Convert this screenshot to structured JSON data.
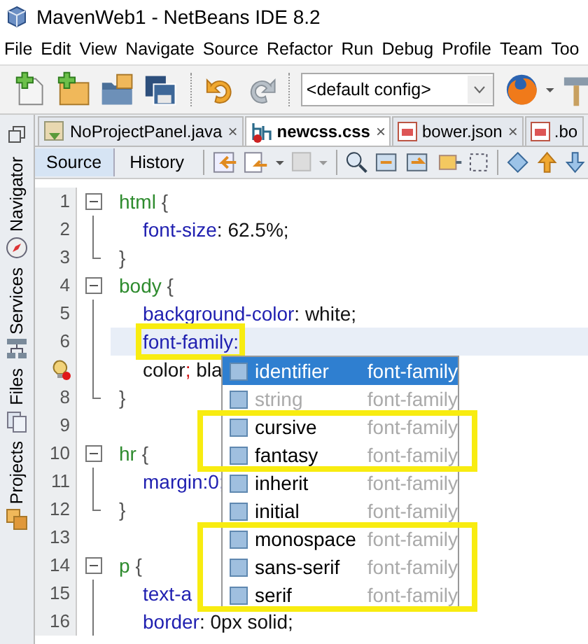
{
  "window": {
    "title": "MavenWeb1 - NetBeans IDE 8.2"
  },
  "menu": [
    "File",
    "Edit",
    "View",
    "Navigate",
    "Source",
    "Refactor",
    "Run",
    "Debug",
    "Profile",
    "Team",
    "Too"
  ],
  "toolbar": {
    "config": "<default config>"
  },
  "side_tabs": [
    {
      "label": "Navigator",
      "kind": "compass"
    },
    {
      "label": "Services",
      "kind": "network"
    },
    {
      "label": "Files",
      "kind": "files"
    },
    {
      "label": "Projects",
      "kind": "projects"
    }
  ],
  "tabs": [
    {
      "label": "NoProjectPanel.java",
      "kind": "java",
      "selected": false,
      "close": "×"
    },
    {
      "label": "newcss.css",
      "kind": "css",
      "selected": true,
      "close": "×"
    },
    {
      "label": "bower.json",
      "kind": "json",
      "selected": false,
      "close": "×"
    },
    {
      "label": ".bo",
      "kind": "json",
      "selected": false
    }
  ],
  "view_tabs": [
    {
      "label": "Source",
      "selected": true
    },
    {
      "label": "History",
      "selected": false
    }
  ],
  "lines": [
    {
      "number": "1",
      "kind": "start",
      "current": false,
      "highlighted": false,
      "tokens": [
        {
          "kind": "selector",
          "text": "html "
        },
        {
          "kind": "brace",
          "text": "{"
        }
      ]
    },
    {
      "number": "2",
      "kind": "middle",
      "current": false,
      "highlighted": false,
      "tokens": [
        {
          "kind": "property",
          "text": "font-size"
        },
        {
          "kind": "value",
          "text": ": 62.5%;"
        }
      ]
    },
    {
      "number": "3",
      "kind": "end",
      "current": false,
      "highlighted": false,
      "tokens": [
        {
          "kind": "brace",
          "text": "}"
        }
      ]
    },
    {
      "number": "4",
      "kind": "start",
      "current": false,
      "highlighted": false,
      "tokens": [
        {
          "kind": "selector",
          "text": "body "
        },
        {
          "kind": "brace",
          "text": "{"
        }
      ]
    },
    {
      "number": "5",
      "kind": "middle",
      "current": false,
      "highlighted": false,
      "tokens": [
        {
          "kind": "property",
          "text": "background-color"
        },
        {
          "kind": "value",
          "text": ": white;"
        }
      ]
    },
    {
      "number": "6",
      "kind": "middle",
      "current": true,
      "highlighted": true,
      "tokens": [
        {
          "kind": "property",
          "text": "font-family"
        },
        {
          "kind": "property",
          "text": ":"
        }
      ]
    },
    {
      "hint": true,
      "kind": "middle",
      "current": false,
      "highlighted": false,
      "tokens": [
        {
          "kind": "value",
          "text": "color"
        },
        {
          "kind": "error",
          "text": ";"
        },
        {
          "kind": "value",
          "text": " bla"
        }
      ]
    },
    {
      "number": "8",
      "kind": "end",
      "current": false,
      "highlighted": false,
      "tokens": [
        {
          "kind": "brace",
          "text": "}"
        }
      ]
    },
    {
      "number": "9",
      "kind": "plain",
      "current": false
    },
    {
      "number": "10",
      "kind": "start",
      "current": false,
      "highlighted": false,
      "tokens": [
        {
          "kind": "selector",
          "text": "hr "
        },
        {
          "kind": "brace",
          "text": "{"
        }
      ]
    },
    {
      "number": "11",
      "kind": "middle",
      "current": false,
      "highlighted": false,
      "tokens": [
        {
          "kind": "property",
          "text": "margin"
        },
        {
          "kind": "property",
          "text": ":0;"
        }
      ]
    },
    {
      "number": "12",
      "kind": "end",
      "current": false,
      "highlighted": false,
      "tokens": [
        {
          "kind": "brace",
          "text": "}"
        }
      ]
    },
    {
      "number": "13",
      "kind": "plain",
      "current": false
    },
    {
      "number": "14",
      "kind": "start",
      "current": false,
      "highlighted": false,
      "tokens": [
        {
          "kind": "selector",
          "text": "p "
        },
        {
          "kind": "brace",
          "text": "{"
        }
      ]
    },
    {
      "number": "15",
      "kind": "middle",
      "current": false,
      "highlighted": false,
      "tokens": [
        {
          "kind": "property",
          "text": "text-a"
        }
      ]
    },
    {
      "number": "16",
      "kind": "middle",
      "current": false,
      "highlighted": false,
      "tokens": [
        {
          "kind": "property",
          "text": "border"
        },
        {
          "kind": "value",
          "text": ": 0px solid;"
        }
      ]
    }
  ],
  "completion": [
    {
      "label": "identifier",
      "type": "font-family",
      "selected": true,
      "disabled": false,
      "highlighted": false
    },
    {
      "label": "string",
      "type": "font-family",
      "selected": false,
      "disabled": true,
      "highlighted": false
    },
    {
      "label": "cursive",
      "type": "font-family",
      "selected": false,
      "disabled": false,
      "highlighted": true
    },
    {
      "label": "fantasy",
      "type": "font-family",
      "selected": false,
      "disabled": false,
      "highlighted": true
    },
    {
      "label": "inherit",
      "type": "font-family",
      "selected": false,
      "disabled": false,
      "highlighted": false
    },
    {
      "label": "initial",
      "type": "font-family",
      "selected": false,
      "disabled": false,
      "highlighted": false
    },
    {
      "label": "monospace",
      "type": "font-family",
      "selected": false,
      "disabled": false,
      "highlighted": true
    },
    {
      "label": "sans-serif",
      "type": "font-family",
      "selected": false,
      "disabled": false,
      "highlighted": true
    },
    {
      "label": "serif",
      "type": "font-family",
      "selected": false,
      "disabled": false,
      "highlighted": true
    }
  ]
}
